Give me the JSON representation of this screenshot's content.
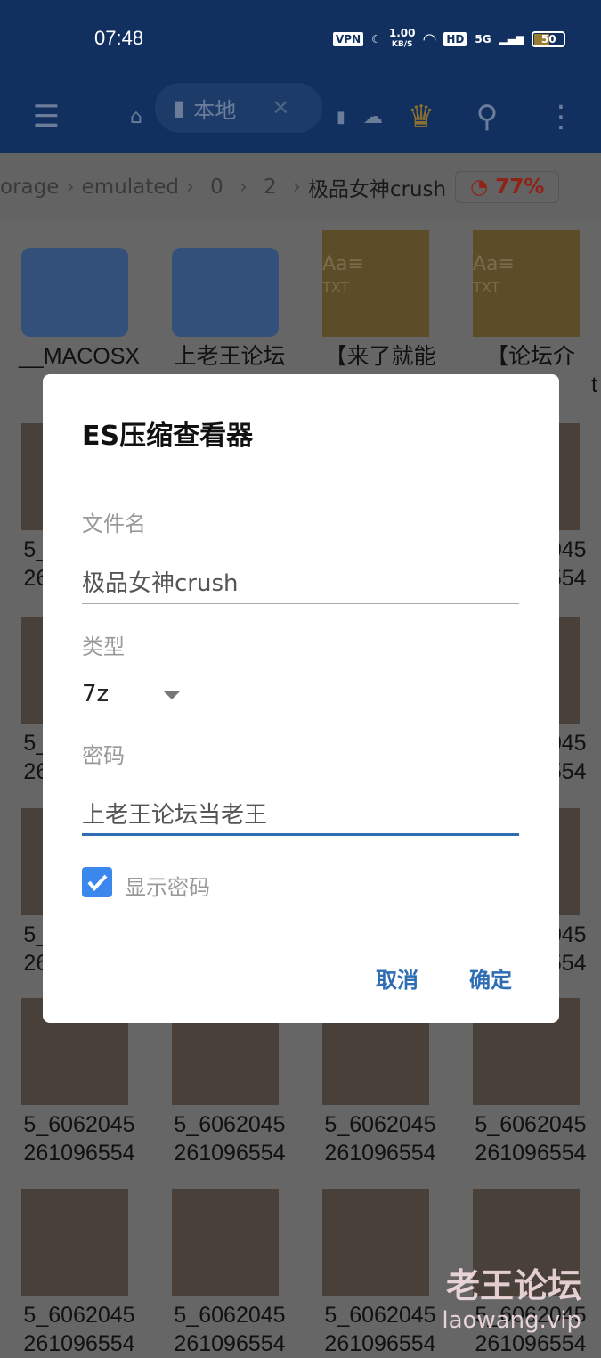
{
  "status_bar": {
    "time": "07:48",
    "vpn": "VPN",
    "speed": "1.00",
    "speed_unit": "KB/S",
    "hd": "HD",
    "network": "5G",
    "battery": "50"
  },
  "toolbar": {
    "tab_label": "本地"
  },
  "breadcrumb": {
    "items": [
      "orage",
      "emulated",
      "0",
      "2"
    ],
    "current": "极品女神crush",
    "usage": "77%"
  },
  "files": [
    {
      "name1": "__MACOSX",
      "name2": "",
      "type": "folder"
    },
    {
      "name1": "上老王论坛",
      "name2": "",
      "type": "folder"
    },
    {
      "name1": "【来了就能",
      "name2": "",
      "type": "txt"
    },
    {
      "name1": "【论坛介",
      "name2": "t",
      "type": "txt"
    }
  ],
  "image_label": {
    "line1": "5_6062045",
    "line2": "261096554"
  },
  "visible_partial": {
    "r2a": "45",
    "r2b": "554"
  },
  "dialog": {
    "title": "ES压缩查看器",
    "filename_label": "文件名",
    "filename_value": "极品女神crush",
    "type_label": "类型",
    "type_value": "7z",
    "password_label": "密码",
    "password_value": "上老王论坛当老王",
    "show_password_label": "显示密码",
    "show_password_checked": true,
    "cancel": "取消",
    "ok": "确定"
  },
  "watermark": {
    "line1": "老王论坛",
    "line2": "laowang.vip"
  },
  "colors": {
    "primary": "#2a77ee",
    "accent": "#2e6db4",
    "usage": "#e03020"
  }
}
